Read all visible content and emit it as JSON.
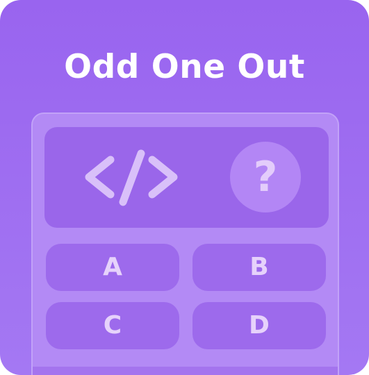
{
  "title": "Odd One Out",
  "prompt": {
    "icon": "code-icon",
    "mystery": "?"
  },
  "options": [
    {
      "label": "A"
    },
    {
      "label": "B"
    },
    {
      "label": "C"
    },
    {
      "label": "D"
    }
  ],
  "colors": {
    "background": "#9964ef",
    "panel": "#b38af5",
    "tile": "#9d6aec",
    "text": "#ffffff"
  }
}
